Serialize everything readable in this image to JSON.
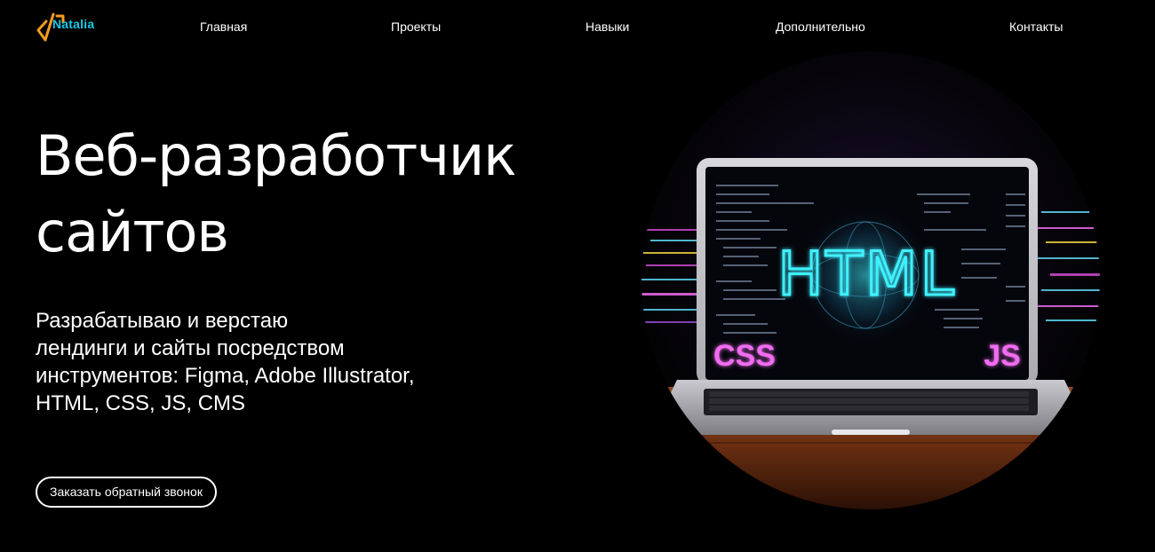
{
  "header": {
    "logo_text": "Natalia",
    "nav": [
      {
        "label": "Главная"
      },
      {
        "label": "Проекты"
      },
      {
        "label": "Навыки"
      },
      {
        "label": "Дополнительно"
      },
      {
        "label": "Контакты"
      }
    ]
  },
  "hero": {
    "title_line1": "Веб-разработчик",
    "title_line2": "сайтов",
    "subtitle_lines": [
      "Разрабатываю и верстаю",
      "лендинги и сайты посредством",
      "инструментов: Figma, Adobe Illustrator,",
      "HTML, CSS, JS, CMS"
    ],
    "cta_label": "Заказать обратный звонок"
  },
  "illustration": {
    "main_label": "HTML",
    "left_label": "CSS",
    "right_label": "JS"
  },
  "colors": {
    "background": "#000000",
    "logo_accent_orange": "#f39c1f",
    "logo_accent_cyan": "#1ec8e6",
    "neon_cyan": "#3ff0ff",
    "neon_pink": "#f06cf0",
    "table_wood": "#7a3a1a"
  },
  "icons": {
    "logo": "code-brackets-logo-icon"
  }
}
